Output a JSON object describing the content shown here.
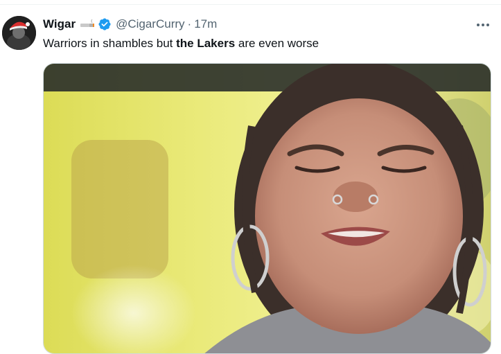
{
  "tweet": {
    "author": {
      "name": "Wigar",
      "badge_emoji": "cigar-emoji",
      "verified": true,
      "verified_icon": "verified-badge-icon",
      "handle": "@CigarCurry",
      "separator": "·",
      "timestamp": "17m"
    },
    "text_before": "Warriors in shambles but ",
    "text_bold": "the Lakers",
    "text_after": " are even worse",
    "more_icon": "more-options-icon",
    "media_icon": "video-still-image"
  },
  "colors": {
    "text_primary": "#0f1419",
    "text_secondary": "#536471",
    "verified_blue": "#1d9bf0",
    "border": "#cfd9de"
  }
}
